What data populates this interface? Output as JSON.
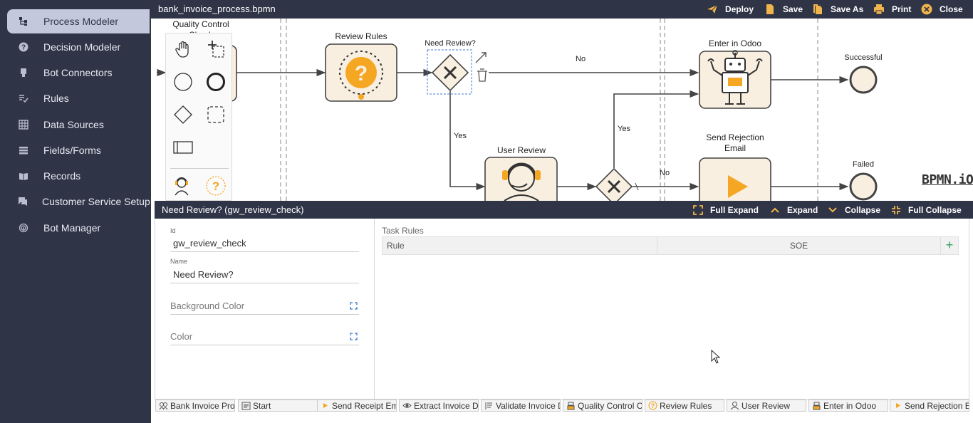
{
  "sidebar": {
    "items": [
      {
        "label": "Process Modeler",
        "icon": "process-icon",
        "active": true
      },
      {
        "label": "Decision Modeler",
        "icon": "question-icon",
        "active": false
      },
      {
        "label": "Bot Connectors",
        "icon": "plug-icon",
        "active": false
      },
      {
        "label": "Rules",
        "icon": "rules-check-icon",
        "active": false
      },
      {
        "label": "Data Sources",
        "icon": "grid-icon",
        "active": false
      },
      {
        "label": "Fields/Forms",
        "icon": "list-icon",
        "active": false
      },
      {
        "label": "Records",
        "icon": "book-icon",
        "active": false
      },
      {
        "label": "Customer Service Setup",
        "icon": "chat-icon",
        "active": false
      },
      {
        "label": "Bot Manager",
        "icon": "fingerprint-icon",
        "active": false
      }
    ]
  },
  "topbar": {
    "file_name": "bank_invoice_process.bpmn",
    "actions": {
      "deploy": "Deploy",
      "save": "Save",
      "save_as": "Save As",
      "print": "Print",
      "close": "Close"
    }
  },
  "diagram": {
    "nodes": {
      "quality_control": "Quality Control Check",
      "review_rules": "Review Rules",
      "need_review": "Need Review?",
      "user_review": "User Review",
      "enter_odoo": "Enter in Odoo",
      "send_rejection": "Send Rejection Email",
      "successful": "Successful",
      "failed": "Failed"
    },
    "edge_labels": {
      "no_top": "No",
      "yes_down": "Yes",
      "yes_up": "Yes",
      "no_bottom": "No"
    },
    "logo": "BPMN.iO",
    "accent_color": "#f5a623",
    "task_fill": "#f8efe0"
  },
  "properties": {
    "title": "Need Review? (gw_review_check)",
    "header_actions": {
      "full_expand": "Full Expand",
      "expand": "Expand",
      "collapse": "Collapse",
      "full_collapse": "Full Collapse"
    },
    "id_label": "Id",
    "id_value": "gw_review_check",
    "name_label": "Name",
    "name_value": "Need Review?",
    "background_color_label": "Background Color",
    "color_label": "Color",
    "task_rules_label": "Task Rules",
    "rules_columns": {
      "rule": "Rule",
      "soe": "SOE",
      "add": "+"
    }
  },
  "bottom_tabs": [
    {
      "label": "Bank Invoice Pro",
      "icon": "people-icon"
    },
    {
      "label": "Start",
      "icon": "form-icon"
    },
    {
      "label": "Send Receipt Em",
      "icon": "play-icon"
    },
    {
      "label": "Extract Invoice D",
      "icon": "eye-icon"
    },
    {
      "label": "Validate Invoice D",
      "icon": "list-check-icon"
    },
    {
      "label": "Quality Control C",
      "icon": "robot-icon"
    },
    {
      "label": "Review Rules",
      "icon": "question-circle-icon"
    },
    {
      "label": "User Review",
      "icon": "agent-icon"
    },
    {
      "label": "Enter in Odoo",
      "icon": "robot-icon"
    },
    {
      "label": "Send Rejection E",
      "icon": "play-icon"
    }
  ]
}
